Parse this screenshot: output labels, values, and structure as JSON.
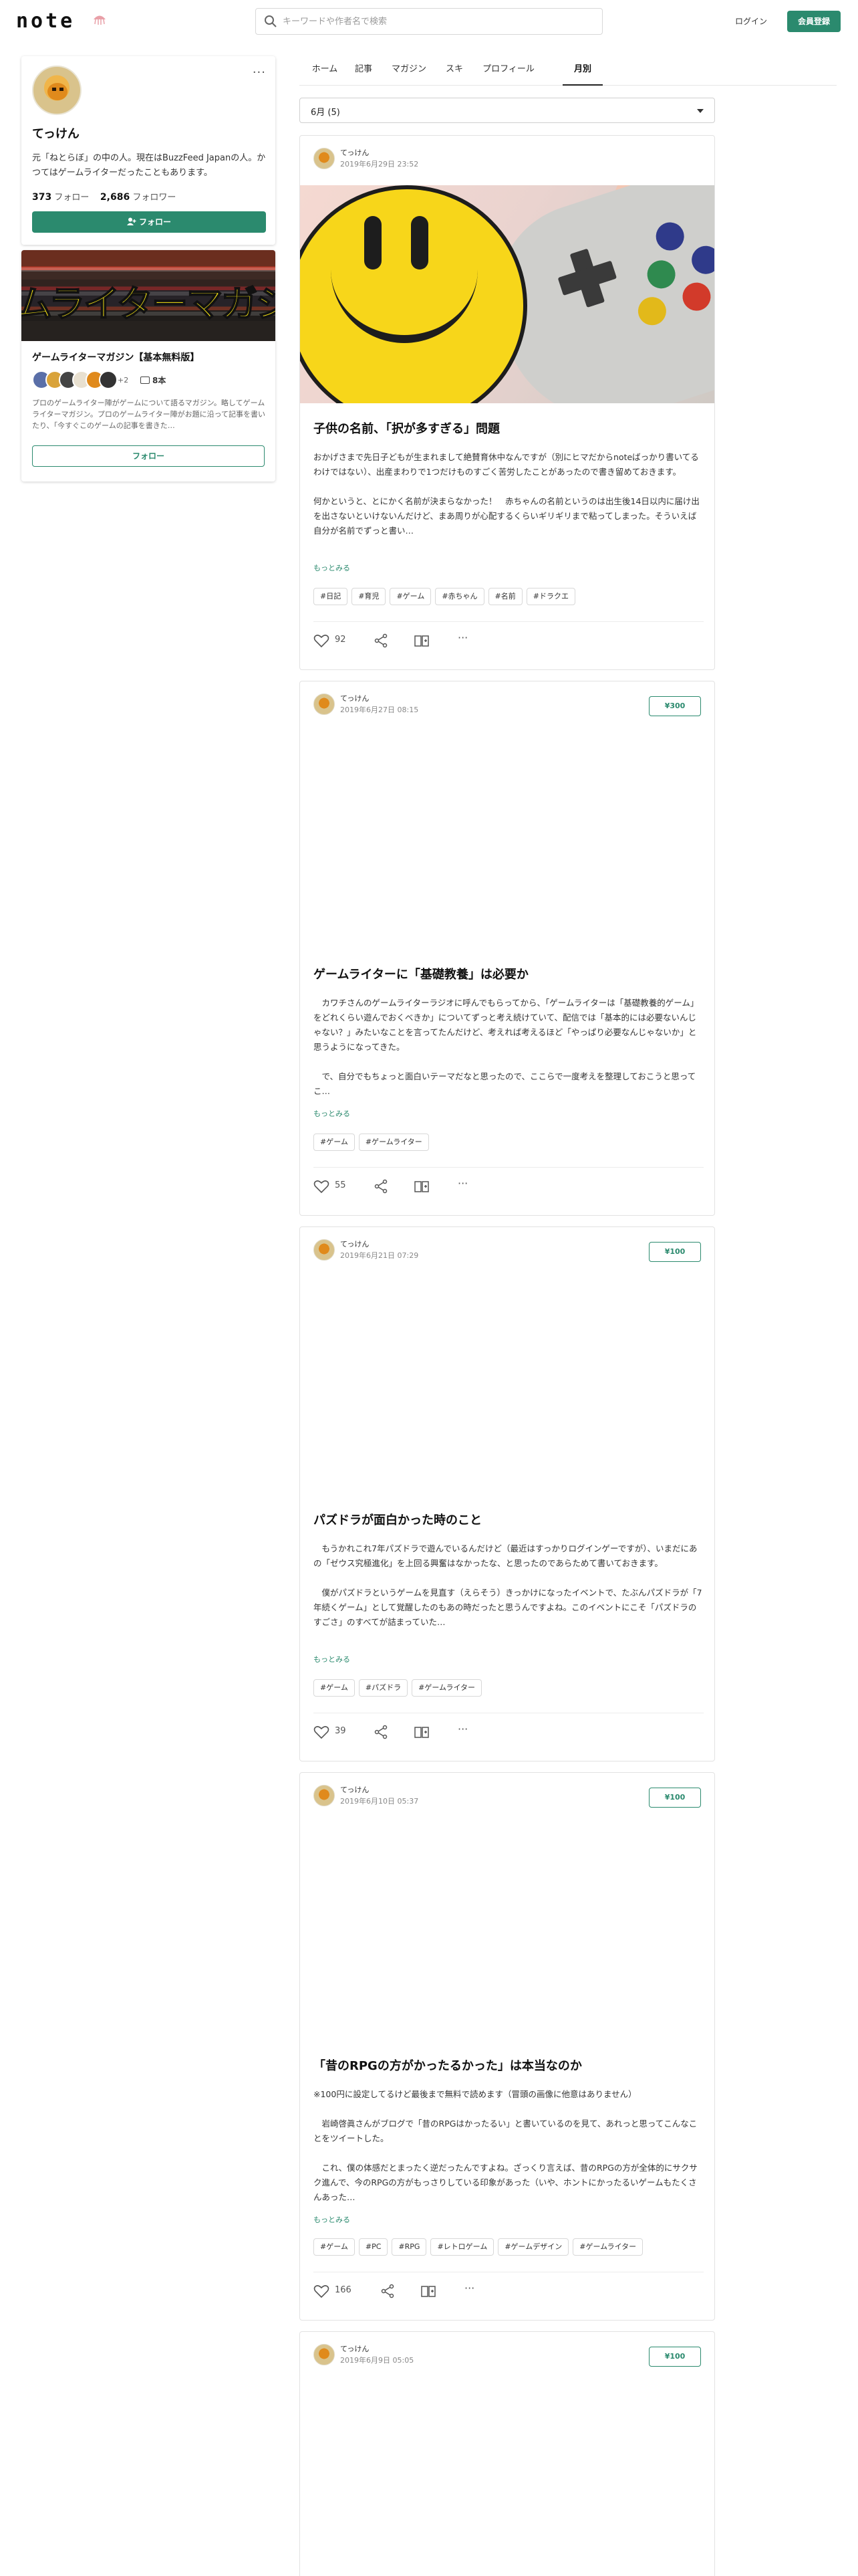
{
  "header": {
    "logo": "note",
    "search_placeholder": "キーワードや作者名で検索",
    "login": "ログイン",
    "signup": "会員登録"
  },
  "profile": {
    "name": "てっけん",
    "bio": "元「ねとらぼ」の中の人。現在はBuzzFeed Japanの人。かつてはゲームライターだったこともあります。",
    "following_count": "373",
    "following_label": "フォロー",
    "followers_count": "2,686",
    "followers_label": "フォロワー",
    "follow_button": "フォロー"
  },
  "magazine": {
    "cover_text": "ムライターマガジ",
    "name": "ゲームライターマガジン【基本無料版】",
    "more_members": "+2",
    "count": "8本",
    "description": "プロのゲームライター陣がゲームについて語るマガジン。略してゲームライターマガジン。プロのゲームライター陣がお題に沿って記事を書いたり、「今すぐこのゲームの記事を書きた…",
    "follow_button": "フォロー"
  },
  "tabs": [
    "ホーム",
    "記事",
    "マガジン",
    "スキ",
    "プロフィール",
    "月別"
  ],
  "active_tab": 5,
  "month_select": "6月 (5)",
  "articles": [
    {
      "author": "てっけん",
      "date": "2019年6月29日 23:52",
      "price": "",
      "title": "子供の名前、「択が多すぎる」問題",
      "body": "おかげさまで先日子どもが生まれまして絶賛育休中なんですが（別にヒマだからnoteばっかり書いてるわけではない）、出産まわりで1つだけものすごく苦労したことがあったので書き留めておきます。\n\n何かというと、とにかく名前が決まらなかった！　赤ちゃんの名前というのは出生後14日以内に届け出を出さないといけないんだけど、まあ周りが心配するくらいギリギリまで粘ってしまった。そういえば自分が名前でずっと書い…",
      "more": "もっとみる",
      "tags": [
        "#日記",
        "#育児",
        "#ゲーム",
        "#赤ちゃん",
        "#名前",
        "#ドラクエ"
      ],
      "likes": "92"
    },
    {
      "author": "てっけん",
      "date": "2019年6月27日 08:15",
      "price": "¥300",
      "title": "ゲームライターに「基礎教養」は必要か",
      "body": "　カワチさんのゲームライターラジオに呼んでもらってから、「ゲームライターは「基礎教養的ゲーム」をどれくらい遊んでおくべきか」についてずっと考え続けていて、配信では「基本的には必要ないんじゃない？」みたいなことを言ってたんだけど、考えれば考えるほど「やっぱり必要なんじゃないか」と思うようになってきた。\n\n　で、自分でもちょっと面白いテーマだなと思ったので、ここらで一度考えを整理しておこうと思ってこ…",
      "more": "もっとみる",
      "tags": [
        "#ゲーム",
        "#ゲームライター"
      ],
      "likes": "55"
    },
    {
      "author": "てっけん",
      "date": "2019年6月21日 07:29",
      "price": "¥100",
      "title": "パズドラが面白かった時のこと",
      "body": "　もうかれこれ7年パズドラで遊んでいるんだけど（最近はすっかりログインゲーですが）、いまだにあの「ゼウス究極進化」を上回る興奮はなかったな、と思ったのであらためて書いておきます。\n\n　僕がパズドラというゲームを見直す（えらそう）きっかけになったイベントで、たぶんパズドラが「7年続くゲーム」として覚醒したのもあの時だったと思うんですよね。このイベントにこそ「パズドラのすごさ」のすべてが詰まっていた…",
      "more": "もっとみる",
      "tags": [
        "#ゲーム",
        "#パズドラ",
        "#ゲームライター"
      ],
      "likes": "39"
    },
    {
      "author": "てっけん",
      "date": "2019年6月10日 05:37",
      "price": "¥100",
      "title": "「昔のRPGの方がかったるかった」は本当なのか",
      "body": "※100円に設定してるけど最後まで無料で読めます（冒頭の画像に他意はありません）\n\n　岩崎啓眞さんがブログで「昔のRPGはかったるい」と書いているのを見て、あれっと思ってこんなことをツイートした。\n\n　これ、僕の体感だとまったく逆だったんですよね。ざっくり言えば、昔のRPGの方が全体的にサクサク進んで、今のRPGの方がもっさりしている印象があった（いや、ホントにかったるいゲームもたくさんあった…",
      "more": "もっとみる",
      "tags": [
        "#ゲーム",
        "#PC",
        "#RPG",
        "#レトロゲーム",
        "#ゲームデザイン",
        "#ゲームライター"
      ],
      "likes": "166"
    },
    {
      "author": "てっけん",
      "date": "2019年6月9日 05:05",
      "price": "¥100",
      "title": "",
      "body": "",
      "more": "",
      "tags": [],
      "likes": ""
    }
  ],
  "colors": {
    "accent": "#2b8a6e",
    "smiley_yellow": "#f7d61a"
  }
}
